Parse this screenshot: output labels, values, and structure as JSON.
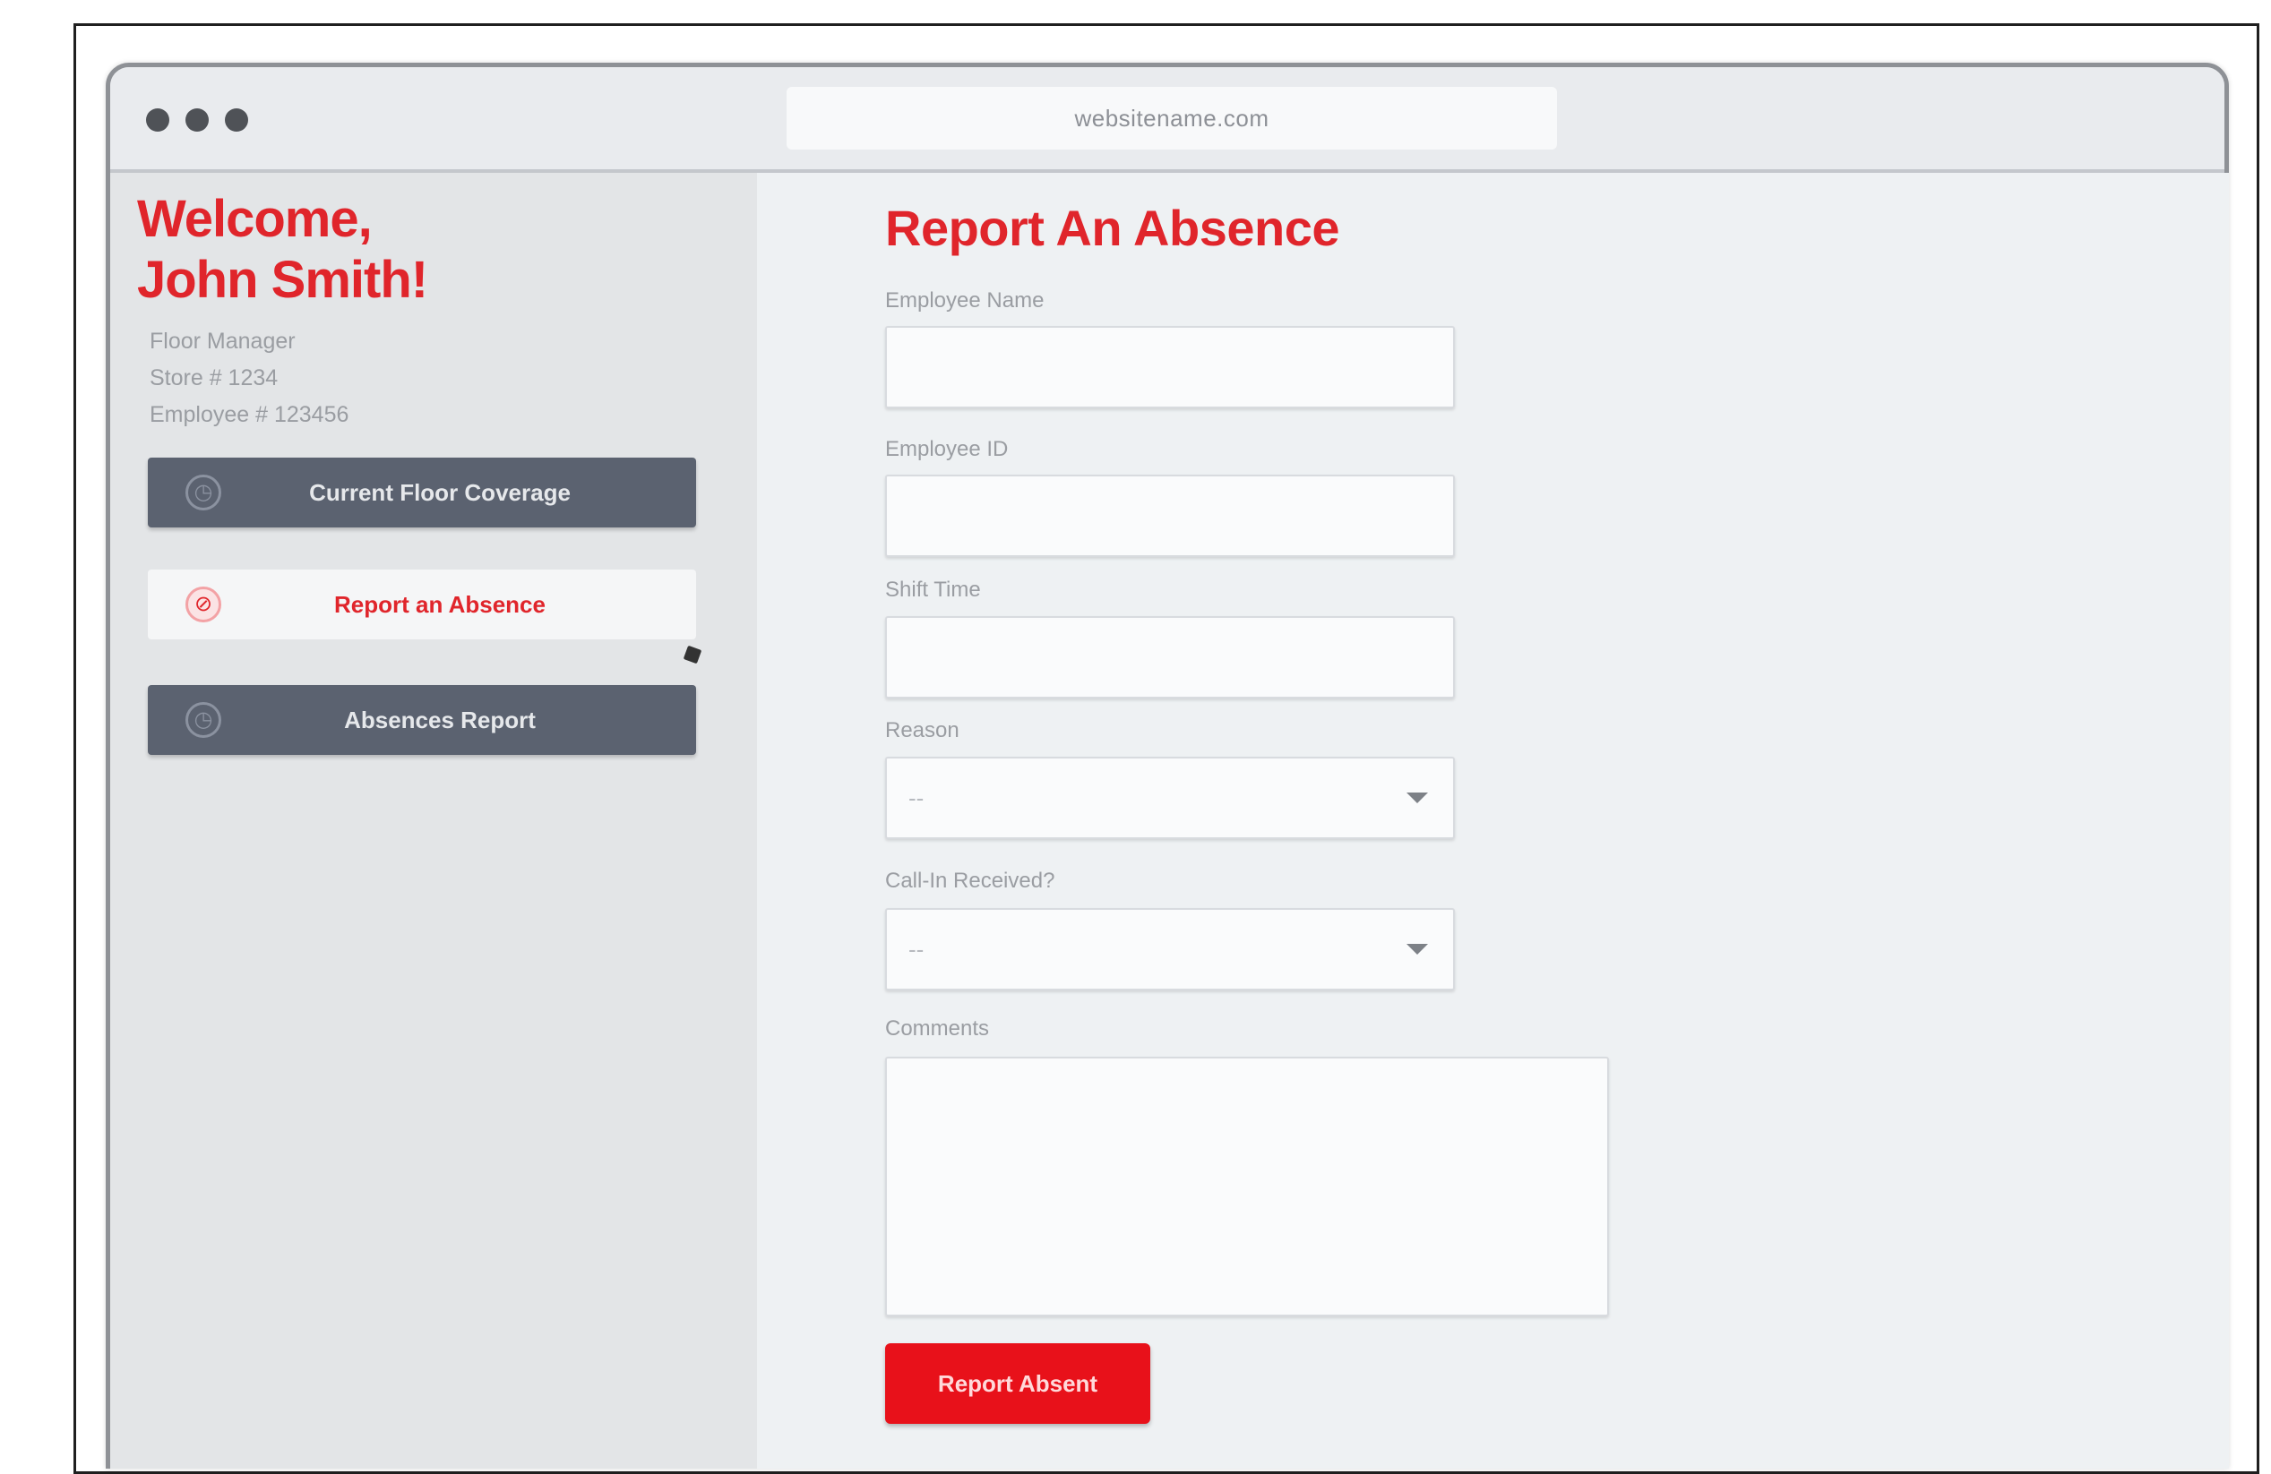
{
  "browser": {
    "url": "websitename.com"
  },
  "sidebar": {
    "welcome_line1": "Welcome,",
    "welcome_line2": "John Smith!",
    "meta": {
      "role": "Floor Manager",
      "store": "Store # 1234",
      "employee": "Employee # 123456"
    },
    "items": [
      {
        "label": "Current Floor Coverage",
        "icon": "clock-icon",
        "state": "default"
      },
      {
        "label": "Report an Absence",
        "icon": "alert-icon",
        "state": "active"
      },
      {
        "label": "Absences Report",
        "icon": "document-icon",
        "state": "default"
      }
    ]
  },
  "form": {
    "title": "Report An Absence",
    "employee_name_label": "Employee Name",
    "employee_name_value": "",
    "employee_id_label": "Employee ID",
    "employee_id_value": "",
    "shift_time_label": "Shift Time",
    "shift_time_value": "",
    "reason_label": "Reason",
    "reason_selected": "--",
    "call_in_label": "Call-In Received?",
    "call_in_selected": "--",
    "comments_label": "Comments",
    "comments_value": "",
    "submit_label": "Report Absent"
  },
  "colors": {
    "accent": "#e0252b",
    "button_red": "#e8111a",
    "nav_dark": "#5b6270",
    "sidebar_bg": "#e3e5e7",
    "main_bg": "#eef1f3"
  }
}
